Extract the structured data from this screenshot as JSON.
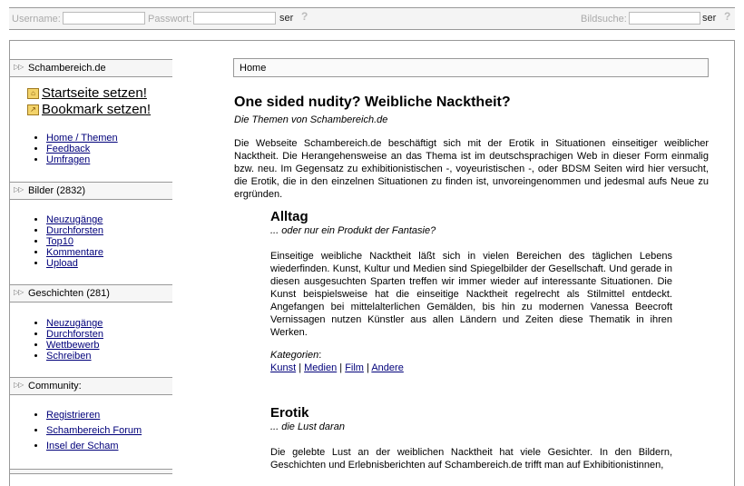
{
  "topbar": {
    "username_label": "Username:",
    "password_label": "Passwort:",
    "login_go": "ser",
    "help": "?",
    "image_search_label": "Bildsuche:",
    "search_go": "ser",
    "search_help": "?"
  },
  "sidebar": {
    "site_header": "Schambereich.de",
    "home_link": "Startseite setzen!",
    "bookmark_link": "Bookmark setzen!",
    "main_links": [
      "Home / Themen",
      "Feedback",
      "Umfragen"
    ],
    "images_header": "Bilder (2832)",
    "images_links": [
      "Neuzugänge",
      "Durchforsten",
      "Top10",
      "Kommentare",
      "Upload"
    ],
    "stories_header": "Geschichten (281)",
    "stories_links": [
      "Neuzugänge",
      "Durchforsten",
      "Wettbewerb",
      "Schreiben"
    ],
    "community_header": "Community:",
    "community_links": [
      "Registrieren",
      "Schambereich Forum",
      "Insel der Scham"
    ]
  },
  "main": {
    "breadcrumb": "Home",
    "title": "One sided nudity? Weibliche Nacktheit?",
    "subtitle": "Die Themen von Schambereich.de",
    "intro": "Die Webseite Schambereich.de beschäftigt sich mit der Erotik in Situationen einseitiger weiblicher Nacktheit. Die Herangehensweise an das Thema ist im deutschsprachigen Web in dieser Form einmalig bzw. neu. Im Gegensatz zu exhibitionistischen -, voyeuristischen -, oder BDSM Seiten wird hier versucht, die Erotik, die in den einzelnen Situationen zu finden ist, unvoreingenommen und jedesmal aufs Neue zu ergründen.",
    "sections": [
      {
        "heading": "Alltag",
        "subtitle": "... oder nur ein Produkt der Fantasie?",
        "text": "Einseitige weibliche Nacktheit läßt sich in vielen Bereichen des täglichen Lebens wiederfinden. Kunst, Kultur und Medien sind Spiegelbilder der Gesellschaft. Und gerade in diesen ausgesuchten Sparten treffen wir immer wieder auf interessante Situationen. Die Kunst beispielsweise hat die einseitige Nacktheit regelrecht als Stilmittel entdeckt. Angefangen bei mittelalterlichen Gemälden, bis hin zu modernen Vanessa Beecroft Vernissagen nutzen Künstler aus allen Ländern und Zeiten diese Thematik in ihren Werken.",
        "categories_label": "Kategorien",
        "categories": [
          "Kunst",
          "Medien",
          "Film",
          "Andere"
        ],
        "separator": "|"
      },
      {
        "heading": "Erotik",
        "subtitle": "... die Lust daran",
        "text": "Die gelebte Lust an der weiblichen Nacktheit hat viele Gesichter. In den Bildern, Geschichten und Erlebnisberichten auf Schambereich.de trifft man auf Exhibitionistinnen,"
      }
    ]
  }
}
